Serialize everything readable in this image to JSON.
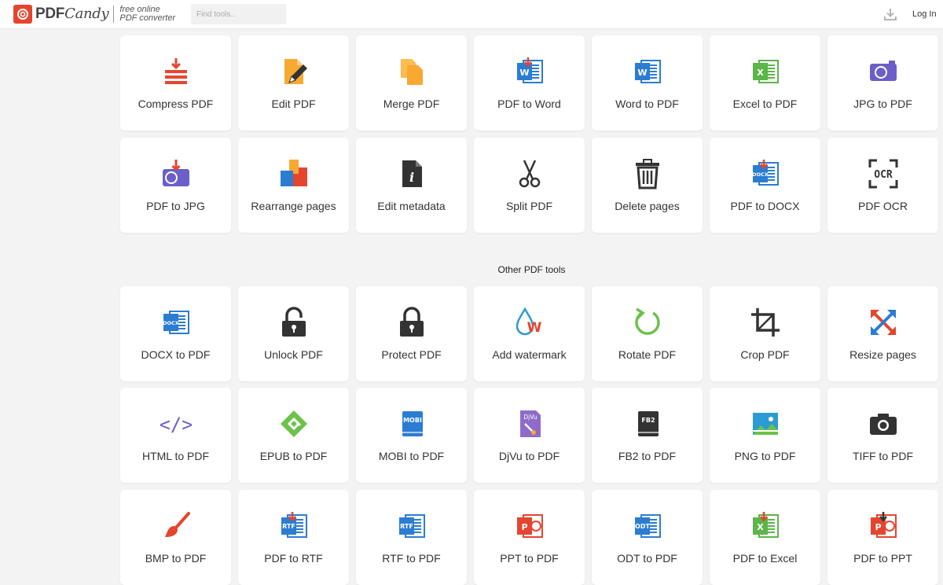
{
  "header": {
    "brand": "PDF",
    "brand_suffix": "Candy",
    "tagline_line1": "free online",
    "tagline_line2": "PDF converter",
    "search_placeholder": "Find tools..",
    "login_label": "Log In"
  },
  "section_other_title": "Other PDF tools",
  "rows": [
    [
      {
        "label": "Compress PDF",
        "icon": "compress-icon"
      },
      {
        "label": "Edit PDF",
        "icon": "edit-icon"
      },
      {
        "label": "Merge PDF",
        "icon": "merge-icon"
      },
      {
        "label": "PDF to Word",
        "icon": "pdf-to-word-icon"
      },
      {
        "label": "Word to PDF",
        "icon": "word-icon"
      },
      {
        "label": "Excel to PDF",
        "icon": "excel-icon"
      },
      {
        "label": "JPG to PDF",
        "icon": "jpg-icon"
      }
    ],
    [
      {
        "label": "PDF to JPG",
        "icon": "pdf-to-jpg-icon"
      },
      {
        "label": "Rearrange pages",
        "icon": "rearrange-icon"
      },
      {
        "label": "Edit metadata",
        "icon": "metadata-icon"
      },
      {
        "label": "Split PDF",
        "icon": "scissors-icon"
      },
      {
        "label": "Delete pages",
        "icon": "trash-icon"
      },
      {
        "label": "PDF to DOCX",
        "icon": "pdf-to-docx-icon"
      },
      {
        "label": "PDF OCR",
        "icon": "ocr-icon"
      }
    ],
    [
      {
        "label": "DOCX to PDF",
        "icon": "docx-icon"
      },
      {
        "label": "Unlock PDF",
        "icon": "unlock-icon"
      },
      {
        "label": "Protect PDF",
        "icon": "lock-icon"
      },
      {
        "label": "Add watermark",
        "icon": "watermark-icon"
      },
      {
        "label": "Rotate PDF",
        "icon": "rotate-icon"
      },
      {
        "label": "Crop PDF",
        "icon": "crop-icon"
      },
      {
        "label": "Resize pages",
        "icon": "resize-icon"
      }
    ],
    [
      {
        "label": "HTML to PDF",
        "icon": "html-code-icon"
      },
      {
        "label": "EPUB to PDF",
        "icon": "epub-icon"
      },
      {
        "label": "MOBI to PDF",
        "icon": "mobi-icon"
      },
      {
        "label": "DjVu to PDF",
        "icon": "djvu-icon"
      },
      {
        "label": "FB2 to PDF",
        "icon": "fb2-icon"
      },
      {
        "label": "PNG to PDF",
        "icon": "png-image-icon"
      },
      {
        "label": "TIFF to PDF",
        "icon": "camera-icon"
      }
    ],
    [
      {
        "label": "BMP to PDF",
        "icon": "paintbrush-icon"
      },
      {
        "label": "PDF to RTF",
        "icon": "pdf-to-rtf-icon"
      },
      {
        "label": "RTF to PDF",
        "icon": "rtf-icon"
      },
      {
        "label": "PPT to PDF",
        "icon": "ppt-icon"
      },
      {
        "label": "ODT to PDF",
        "icon": "odt-icon"
      },
      {
        "label": "PDF to Excel",
        "icon": "pdf-to-excel-icon"
      },
      {
        "label": "PDF to PPT",
        "icon": "pdf-to-ppt-icon"
      }
    ]
  ],
  "icon_text": {
    "word_letter": "W",
    "excel_letter": "X",
    "ppt_letter": "P",
    "docx": "DOCX",
    "ocr": "OCR",
    "mobi": "MOBI",
    "djvu": "DjVu",
    "fb2": "FB2",
    "rtf": "RTF",
    "odt": "ODT",
    "html": "</>",
    "watermark_letter": "W",
    "metadata_letter": "i"
  },
  "colors": {
    "brand_red": "#e5452f",
    "word_blue": "#2b7cd3",
    "excel_green": "#5bb548",
    "ppt_red": "#e5452f",
    "jpg_purple": "#6a5fc9",
    "orange": "#f7a932",
    "dark": "#333333",
    "rotate_green": "#6cc24a",
    "epub_green": "#6cc24a",
    "mobi_blue": "#2b7cd3",
    "djvu_purple": "#8d6cc9",
    "png_blue": "#2b9bd3",
    "watermark_blue": "#2b9bd3"
  }
}
